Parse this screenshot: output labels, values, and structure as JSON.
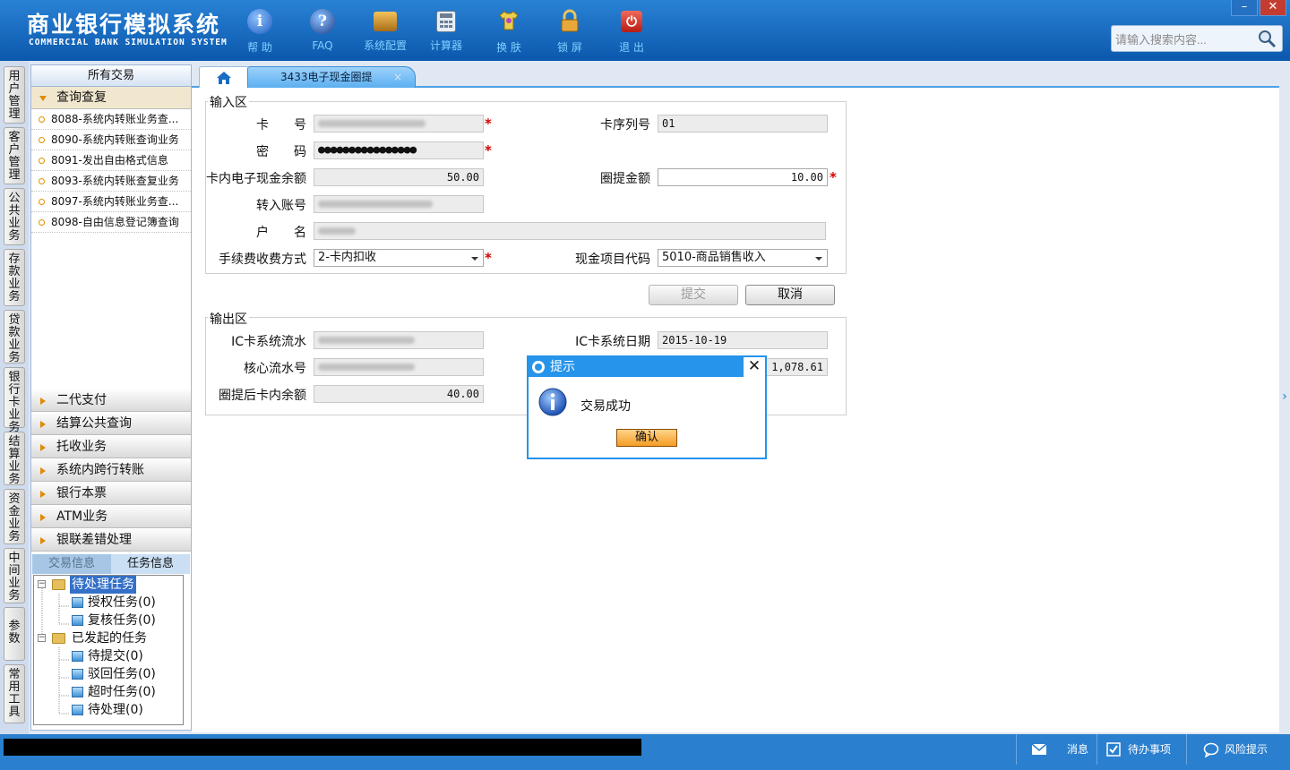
{
  "app": {
    "title_cn": "商业银行模拟系统",
    "title_en": "COMMERCIAL BANK SIMULATION SYSTEM",
    "search_placeholder": "请输入搜索内容...",
    "window_minimize": "–",
    "window_close": "✕"
  },
  "toolbar": [
    {
      "label": "帮 助",
      "icon": "info-icon"
    },
    {
      "label": "FAQ",
      "icon": "faq-icon"
    },
    {
      "label": "系统配置",
      "icon": "toolbox-icon"
    },
    {
      "label": "计算器",
      "icon": "calculator-icon"
    },
    {
      "label": "换 肤",
      "icon": "shirt-icon"
    },
    {
      "label": "锁 屏",
      "icon": "lock-icon"
    },
    {
      "label": "退 出",
      "icon": "power-icon"
    }
  ],
  "vertical_tabs": [
    "用户管理",
    "客户管理",
    "公共业务",
    "存款业务",
    "贷款业务",
    "银行卡业务",
    "结算业务",
    "资金业务",
    "中间业务",
    "参数",
    "常用工具"
  ],
  "sidebar": {
    "header": "所有交易",
    "open_group": "查询查复",
    "open_items": [
      "8088-系统内转账业务查...",
      "8090-系统内转账查询业务",
      "8091-发出自由格式信息",
      "8093-系统内转账查复业务",
      "8097-系统内转账业务查...",
      "8098-自由信息登记簿查询"
    ],
    "groups": [
      "二代支付",
      "结算公共查询",
      "托收业务",
      "系统内跨行转账",
      "银行本票",
      "ATM业务",
      "银联差错处理"
    ],
    "bottom_tabs": [
      "交易信息",
      "任务信息"
    ],
    "tree": {
      "pending": "待处理任务",
      "auth": "授权任务(0)",
      "review": "复核任务(0)",
      "initiated": "已发起的任务",
      "to_submit": "待提交(0)",
      "rejected": "驳回任务(0)",
      "timeout": "超时任务(0)",
      "to_process": "待处理(0)"
    }
  },
  "tab": {
    "label": "3433电子现金圈提",
    "close": "×"
  },
  "form": {
    "input_title": "输入区",
    "card_no_label": "卡　　号",
    "card_seq_label": "卡序列号",
    "card_seq_value": "01",
    "password_label": "密　　码",
    "password_value": "●●●●●●●●●●●●●●●●",
    "ecash_balance_label": "卡内电子现金余额",
    "ecash_balance_value": "50.00",
    "amount_label": "圈提金额",
    "amount_value": "10.00",
    "to_account_label": "转入账号",
    "name_label": "户　　名",
    "fee_method_label": "手续费收费方式",
    "fee_method_value": "2-卡内扣收",
    "cash_item_label": "现金项目代码",
    "cash_item_value": "5010-商品销售收入",
    "required_mark": "*",
    "submit_label": "提交",
    "cancel_label": "取消",
    "output_title": "输出区",
    "ic_serial_label": "IC卡系统流水",
    "ic_date_label": "IC卡系统日期",
    "ic_date_value": "2015-10-19",
    "core_serial_label": "核心流水号",
    "partial_value": "1,078.61",
    "after_balance_label": "圈提后卡内余额",
    "after_balance_value": "40.00"
  },
  "dialog": {
    "title": "提示",
    "message": "交易成功",
    "ok_label": "确认",
    "close": "✕"
  },
  "statusbar": {
    "message": "消息",
    "todo": "待办事项",
    "risk": "风险提示"
  },
  "colors": {
    "header_blue": "#0b58ad",
    "accent_blue": "#2594ea",
    "required_red": "#d40000",
    "orange": "#f49d26"
  }
}
